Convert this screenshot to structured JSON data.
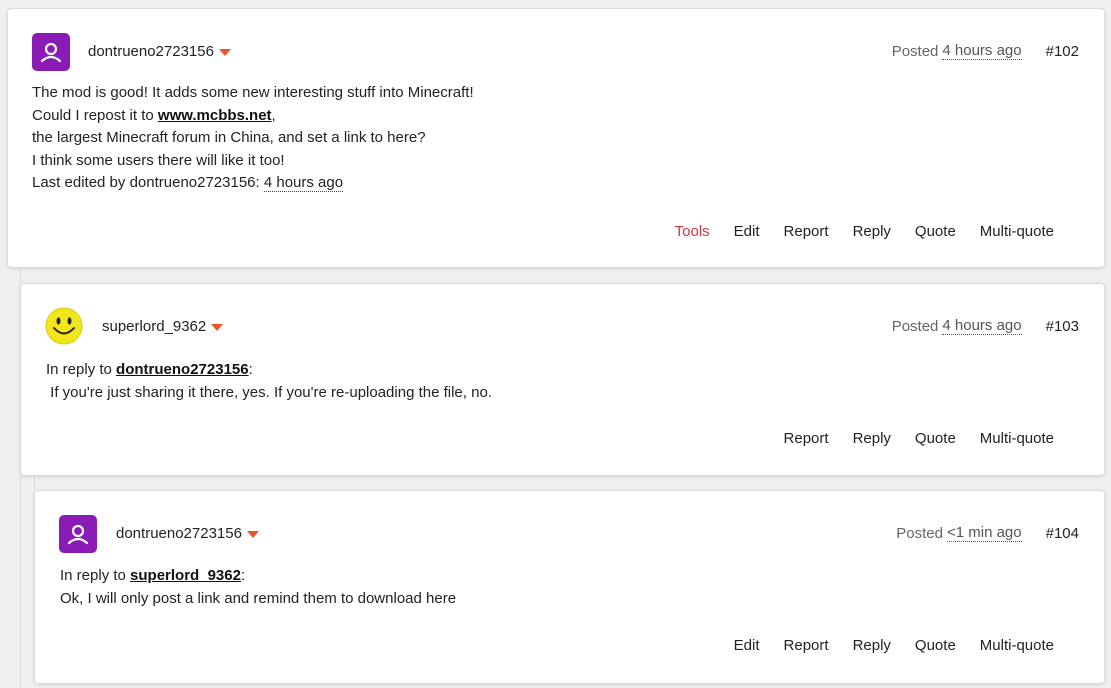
{
  "posts": [
    {
      "id": "102",
      "avatar": "user-icon",
      "username": "dontrueno2723156",
      "posted_label": "Posted",
      "posted_time": "4 hours ago",
      "post_number": "#102",
      "body": {
        "line1": "The mod is good! It adds some new interesting stuff into Minecraft!",
        "line2_prefix": "Could I repost it to ",
        "line2_link": "www.mcbbs.net",
        "line2_suffix": ",",
        "line3": "the largest Minecraft forum in China, and set a link to here?",
        "line4": "I think some users there will like it too!",
        "edited_prefix": "Last edited by dontrueno2723156: ",
        "edited_time": "4 hours ago"
      },
      "actions": [
        "Tools",
        "Edit",
        "Report",
        "Reply",
        "Quote",
        "Multi-quote"
      ]
    },
    {
      "id": "103",
      "avatar": "smiley-icon",
      "username": "superlord_9362",
      "posted_label": "Posted",
      "posted_time": "4 hours ago",
      "post_number": "#103",
      "body": {
        "reply_prefix": "In reply to ",
        "reply_to": "dontrueno2723156",
        "reply_suffix": ":",
        "line1": " If you're just sharing it there, yes. If you're re-uploading the file, no."
      },
      "actions": [
        "Report",
        "Reply",
        "Quote",
        "Multi-quote"
      ]
    },
    {
      "id": "104",
      "avatar": "user-icon",
      "username": "dontrueno2723156",
      "posted_label": "Posted",
      "posted_time": "<1 min ago",
      "post_number": "#104",
      "body": {
        "reply_prefix": "In reply to ",
        "reply_to": "superlord_9362",
        "reply_suffix": ":",
        "line1": "Ok, I will only post a link and remind them to download here"
      },
      "actions": [
        "Edit",
        "Report",
        "Reply",
        "Quote",
        "Multi-quote"
      ]
    }
  ],
  "colors": {
    "avatar_purple": "#8a1bb5",
    "caret_orange": "#e8562a",
    "tools_red": "#d4363a",
    "smiley_yellow": "#f2e61a"
  }
}
